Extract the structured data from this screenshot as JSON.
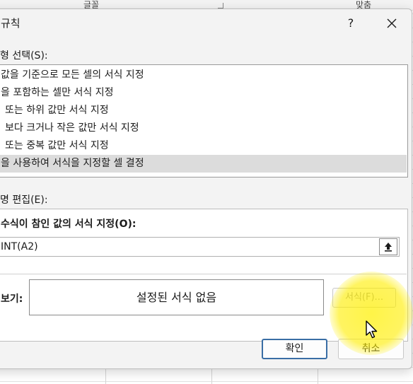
{
  "background": {
    "ribbon_left": "글꼴",
    "ribbon_right": "맞춤"
  },
  "dialog": {
    "title": "규칙",
    "help": "?",
    "section_type_label": "형 선택(S):",
    "rule_types": [
      "값을 기준으로 모든 셀의 서식 지정",
      "을 포함하는 셀만 서식 지정",
      "또는 하위 값만 서식 지정",
      "보다 크거나 작은 값만 서식 지정",
      "또는 중복 값만 서식 지정",
      "을 사용하여 서식을 지정할 셀 결정"
    ],
    "selected_index": 5,
    "section_edit_label": "명 편집(E):",
    "formula_caption": "수식이 참인 값의 서식 지정(O):",
    "formula_value": "INT(A2)",
    "preview_label": "보기:",
    "preview_text": "설정된 서식 없음",
    "format_button": "서식(F)...",
    "ok_button": "확인",
    "cancel_button": "취소"
  },
  "colors": {
    "selection": "#dcdcdc",
    "highlight": "#fff000",
    "ok_border": "#3a6ea5"
  }
}
